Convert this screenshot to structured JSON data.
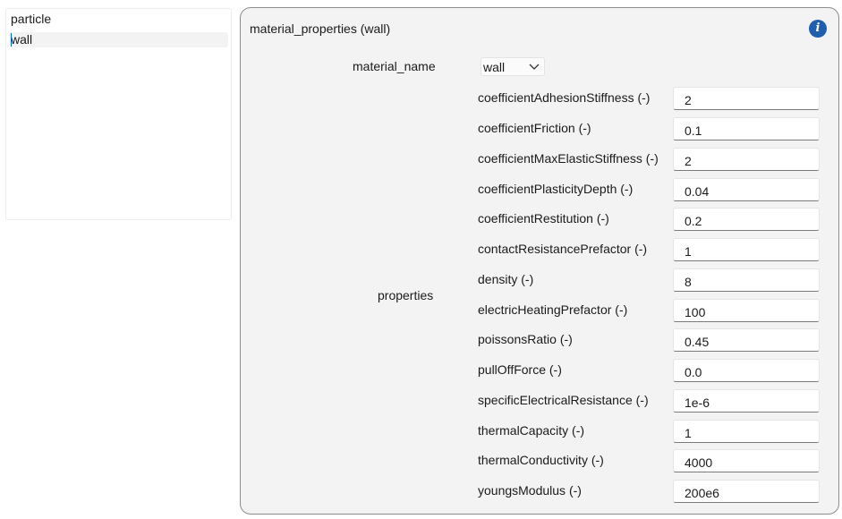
{
  "list": {
    "items": [
      {
        "label": "particle"
      },
      {
        "label": "wall"
      }
    ]
  },
  "panel": {
    "title": "material_properties (wall)",
    "material_name_label": "material_name",
    "material_name_value": "wall",
    "properties_label": "properties",
    "properties": [
      {
        "label": "coefficientAdhesionStiffness (-)",
        "value": "2"
      },
      {
        "label": "coefficientFriction (-)",
        "value": "0.1"
      },
      {
        "label": "coefficientMaxElasticStiffness (-)",
        "value": "2"
      },
      {
        "label": "coefficientPlasticityDepth (-)",
        "value": "0.04"
      },
      {
        "label": "coefficientRestitution (-)",
        "value": "0.2"
      },
      {
        "label": "contactResistancePrefactor (-)",
        "value": "1"
      },
      {
        "label": "density (-)",
        "value": "8"
      },
      {
        "label": "electricHeatingPrefactor (-)",
        "value": "100"
      },
      {
        "label": "poissonsRatio (-)",
        "value": "0.45"
      },
      {
        "label": "pullOffForce (-)",
        "value": "0.0"
      },
      {
        "label": "specificElectricalResistance (-)",
        "value": "1e-6"
      },
      {
        "label": "thermalCapacity (-)",
        "value": "1"
      },
      {
        "label": "thermalConductivity (-)",
        "value": "4000"
      },
      {
        "label": "youngsModulus (-)",
        "value": "200e6"
      }
    ]
  },
  "icons": {
    "info": "info-icon",
    "dropdown": "chevron-down-icon"
  },
  "colors": {
    "accent": "#1f5fae",
    "caret": "#0a64c8",
    "panel_bg": "#f3f3f3"
  }
}
